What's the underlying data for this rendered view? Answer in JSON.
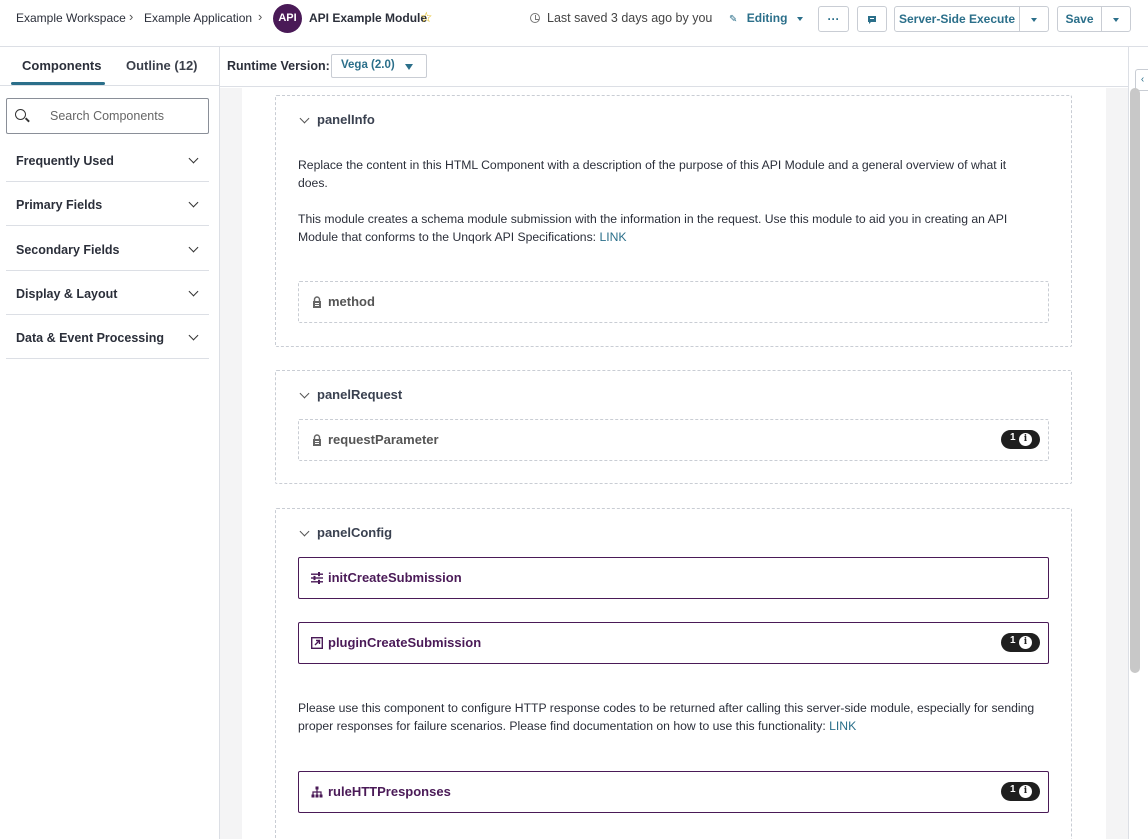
{
  "breadcrumb": {
    "workspace": "Example Workspace",
    "application": "Example Application",
    "module_badge": "API",
    "module_name": "API Example Module"
  },
  "status": {
    "last_saved": "Last saved 3 days ago by you",
    "mode": "Editing"
  },
  "toolbar": {
    "more": "···",
    "server_side_execute": "Server-Side Execute",
    "save": "Save"
  },
  "sidebar": {
    "tabs": [
      "Components",
      "Outline (12)"
    ],
    "active_tab": "Components",
    "search_placeholder": "Search Components",
    "groups": [
      "Frequently Used",
      "Primary Fields",
      "Secondary Fields",
      "Display & Layout",
      "Data & Event Processing"
    ]
  },
  "runtime": {
    "label": "Runtime Version:",
    "value": "Vega (2.0)"
  },
  "panels": {
    "info": {
      "title": "panelInfo",
      "para1": "Replace the content in this HTML Component with a description of the purpose of this API Module and a general overview of what it does.",
      "para2": "This module creates a schema module submission with the information in the request. Use this module to aid you in creating an API Module that conforms to the Unqork API Specifications: ",
      "para2_link": "LINK",
      "method": "method"
    },
    "request": {
      "title": "panelRequest",
      "request_parameter": "requestParameter",
      "request_parameter_count": "1"
    },
    "config": {
      "title": "panelConfig",
      "init": "initCreateSubmission",
      "plugin": "pluginCreateSubmission",
      "plugin_count": "1",
      "para": "Please use this component to configure HTTP response codes to be returned after calling this server-side module, especially for sending proper responses for failure scenarios. Please find documentation on how to use this functionality: ",
      "para_link": "LINK",
      "rule": "ruleHTTPresponses",
      "rule_count": "1"
    }
  },
  "colors": {
    "accent": "#2b6f8a",
    "server_component": "#4a1a57",
    "star": "#e3b400"
  }
}
